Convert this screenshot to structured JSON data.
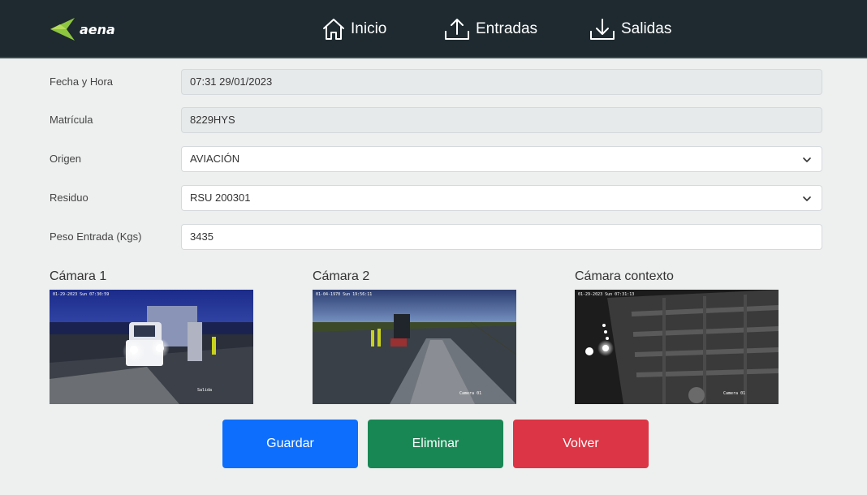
{
  "header": {
    "logo_text": "aena",
    "nav": [
      {
        "label": "Inicio",
        "icon": "home-icon"
      },
      {
        "label": "Entradas",
        "icon": "upload-icon"
      },
      {
        "label": "Salidas",
        "icon": "download-icon"
      }
    ]
  },
  "form": {
    "fecha_label": "Fecha y Hora",
    "fecha_value": "07:31 29/01/2023",
    "matricula_label": "Matrícula",
    "matricula_value": "8229HYS",
    "origen_label": "Origen",
    "origen_value": "AVIACIÓN",
    "residuo_label": "Residuo",
    "residuo_value": "RSU 200301",
    "peso_label": "Peso Entrada (Kgs)",
    "peso_value": "3435"
  },
  "cameras": [
    {
      "title": "Cámara 1",
      "timestamp": "01-29-2023 Sun 07:30:59",
      "tag": "Salida"
    },
    {
      "title": "Cámara 2",
      "timestamp": "01-04-1970 Sun 19:56:11",
      "tag": "Camera 01"
    },
    {
      "title": "Cámara contexto",
      "timestamp": "01-29-2023 Sun 07:31:13",
      "tag": "Camera 01"
    }
  ],
  "buttons": {
    "guardar": "Guardar",
    "eliminar": "Eliminar",
    "volver": "Volver"
  },
  "colors": {
    "header_bg": "#1e2a30",
    "guardar": "#0d6efd",
    "eliminar": "#198754",
    "volver": "#dc3545",
    "logo_green": "#8dc63f"
  }
}
